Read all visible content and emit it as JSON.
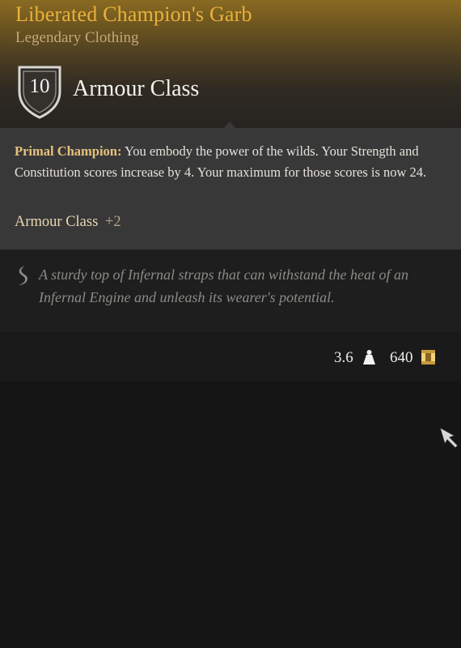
{
  "item": {
    "name": "Liberated Champion's Garb",
    "rarity": "Legendary Clothing",
    "rarity_color": "#e9b13a"
  },
  "armour": {
    "value": "10",
    "label": "Armour Class",
    "icon": "shield-icon"
  },
  "feature": {
    "title": "Primal Champion:",
    "description": " You embody the power of the wilds. Your Strength and Constitution scores increase by 4. Your maximum for those scores is now 24.",
    "bonus_label": "Armour Class",
    "bonus_value": "+2"
  },
  "flavour": {
    "icon": "quill-icon",
    "text": "A sturdy top of Infernal straps that can withstand the heat of an Infernal Engine and unleash its wearer's potential."
  },
  "stats": {
    "weight": "3.6",
    "weight_icon": "weight-icon",
    "price": "640",
    "price_icon": "gold-coin-icon"
  },
  "colors": {
    "header_gold": "#8a6a22",
    "panel": "#383838",
    "background": "#151515"
  }
}
